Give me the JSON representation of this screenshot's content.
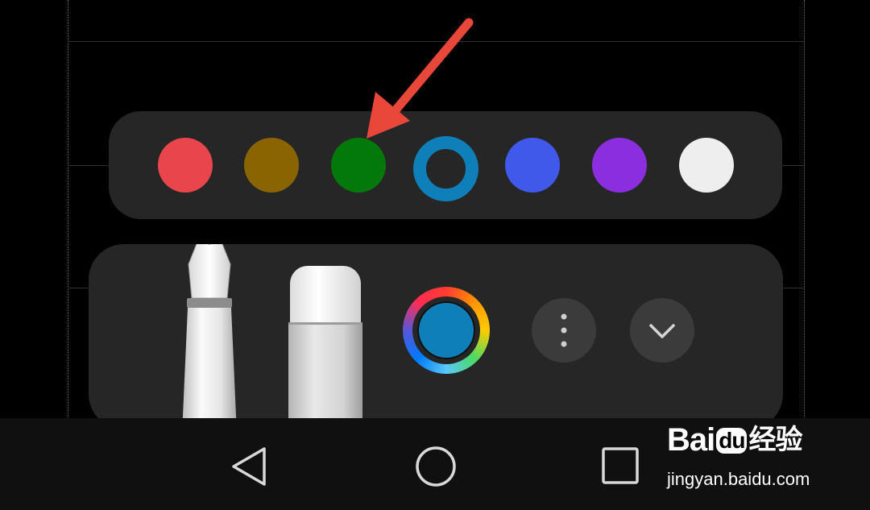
{
  "palette": {
    "swatches": [
      {
        "name": "red",
        "color": "#e8464c",
        "selected": false
      },
      {
        "name": "olive",
        "color": "#8a6400",
        "selected": false
      },
      {
        "name": "green",
        "color": "#03780b",
        "selected": false
      },
      {
        "name": "teal-blue",
        "color": "#0f7fba",
        "selected": true
      },
      {
        "name": "blue",
        "color": "#4059ea",
        "selected": false
      },
      {
        "name": "purple",
        "color": "#8a2ee0",
        "selected": false
      },
      {
        "name": "white",
        "color": "#eeeeee",
        "selected": false
      }
    ]
  },
  "tools": {
    "current_color": "#0f7fba",
    "items": [
      "pen-tool",
      "eraser-tool",
      "color-picker",
      "more-options",
      "collapse"
    ]
  },
  "navbar": {
    "buttons": [
      "back-icon",
      "home-icon",
      "recents-icon"
    ]
  },
  "watermark": {
    "logo_bai": "Bai",
    "logo_du": "du",
    "logo_jingyan": "经验",
    "url": "jingyan.baidu.com"
  },
  "annotation": {
    "arrow_color": "#e8473a"
  }
}
